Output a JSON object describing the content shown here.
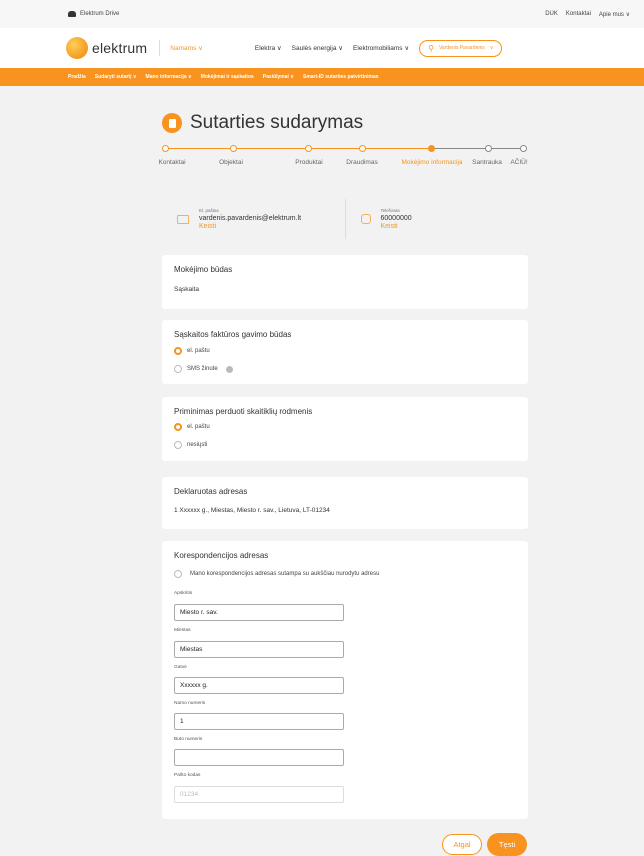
{
  "topbar": {
    "drive": "Elektrum Drive",
    "links": [
      "DUK",
      "Kontaktai",
      "Apie mus ∨"
    ]
  },
  "header": {
    "logo": "elektrum",
    "segment": "Namams ∨",
    "nav": [
      "Elektra ∨",
      "Saulės energija ∨",
      "Elektromobiliams ∨"
    ],
    "user": "Vardenis Pavardenis"
  },
  "orange_nav": [
    "Pradžia",
    "Sudaryti sutartį ∨",
    "Mano informacija ∨",
    "Mokėjimai ir sąskaitos",
    "Pasiūlymai ∨",
    "Smart-ID sutarties patvirtinimas"
  ],
  "page_title": "Sutarties sudarymas",
  "steps": [
    {
      "label": "Kontaktai",
      "state": "done"
    },
    {
      "label": "Objektai",
      "state": "done"
    },
    {
      "label": "Produktai",
      "state": "done"
    },
    {
      "label": "Draudimas",
      "state": "done"
    },
    {
      "label": "Mokėjimo informacija",
      "state": "active"
    },
    {
      "label": "Santrauka",
      "state": "todo"
    },
    {
      "label": "AČIŪ!",
      "state": "todo"
    }
  ],
  "contact": {
    "email_label": "El. paštas",
    "email": "vardenis.pavardenis@elektrum.lt",
    "email_change": "Keisti",
    "phone_label": "Telefonas",
    "phone": "60000000",
    "phone_change": "Keisti"
  },
  "payment": {
    "title": "Mokėjimo būdas",
    "value": "Sąskaita"
  },
  "invoice": {
    "title": "Sąskaitos faktūros gavimo būdas",
    "options": [
      "el. paštu",
      "SMS žinute"
    ],
    "selected": 0
  },
  "reminder": {
    "title": "Priminimas perduoti skaitiklių rodmenis",
    "options": [
      "el. paštu",
      "nesiųsti"
    ],
    "selected": 0
  },
  "declared": {
    "title": "Deklaruotas adresas",
    "value": "1 Xxxxxx g., Miestas, Miesto r. sav., Lietuva, LT-01234"
  },
  "correspondence": {
    "title": "Korespondencijos adresas",
    "checkbox": "Mano korespondencijos adresas sutampa su aukščiau nurodytu adresu",
    "fields": [
      {
        "label": "Apskritis",
        "value": "Miesto r. sav."
      },
      {
        "label": "Miestas",
        "value": "Miestas"
      },
      {
        "label": "Gatvė",
        "value": "Xxxxxx g."
      },
      {
        "label": "Namo numeris",
        "value": "1"
      },
      {
        "label": "Buto numeris",
        "value": ""
      },
      {
        "label": "Pašto kodas",
        "value": "01234"
      }
    ]
  },
  "buttons": {
    "back": "Atgal",
    "next": "Tęsti"
  },
  "colors": {
    "accent": "#f7931e"
  }
}
